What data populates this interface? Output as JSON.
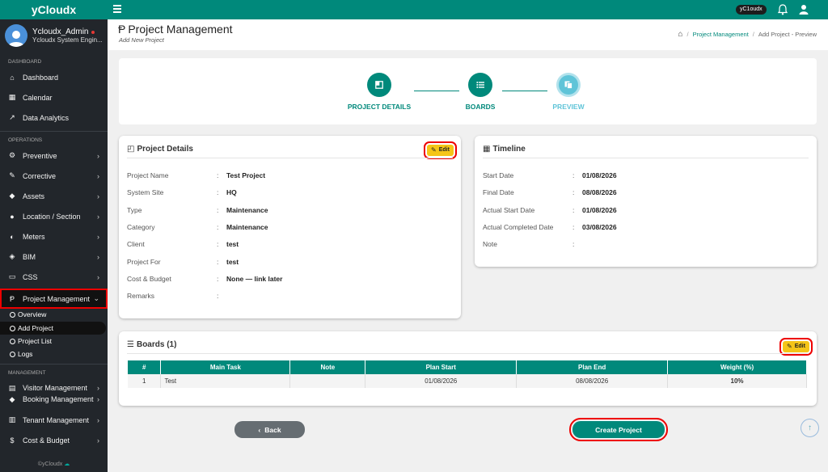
{
  "sidebar": {
    "brand": "yCloudx",
    "user": {
      "name": "Ycloudx_Admin",
      "role": "Ycloudx System Engin..."
    },
    "sections": {
      "dashboard": "DASHBOARD",
      "operations": "OPERATIONS",
      "management": "MANAGEMENT"
    },
    "items": {
      "dashboard": "Dashboard",
      "calendar": "Calendar",
      "data_analytics": "Data Analytics",
      "preventive": "Preventive",
      "corrective": "Corrective",
      "assets": "Assets",
      "location": "Location / Section",
      "meters": "Meters",
      "bim": "BIM",
      "css": "CSS",
      "project_management": "Project Management",
      "visitor_management": "Visitor Management",
      "booking_management": "Booking Management",
      "tenant_management": "Tenant Management",
      "cost_budget": "Cost & Budget"
    },
    "project_sub": {
      "overview": "Overview",
      "add_project": "Add Project",
      "project_list": "Project List",
      "logs": "Logs"
    },
    "footer": "©yCloudx"
  },
  "topbar": {
    "tag": "yC1oudx"
  },
  "header": {
    "title": "Project Management",
    "subtitle": "Add New Project",
    "breadcrumb": {
      "link": "Project Management",
      "current": "Add Project - Preview",
      "sep": "/"
    }
  },
  "stepper": {
    "steps": [
      "PROJECT DETAILS",
      "BOARDS",
      "PREVIEW"
    ]
  },
  "project_details": {
    "title": "Project Details",
    "edit_label": "Edit",
    "rows": [
      {
        "label": "Project Name",
        "value": "Test Project"
      },
      {
        "label": "System Site",
        "value": "HQ"
      },
      {
        "label": "Type",
        "value": "Maintenance"
      },
      {
        "label": "Category",
        "value": "Maintenance"
      },
      {
        "label": "Client",
        "value": "test"
      },
      {
        "label": "Project For",
        "value": "test"
      },
      {
        "label": "Cost & Budget",
        "value": "None — link later"
      },
      {
        "label": "Remarks",
        "value": ""
      }
    ]
  },
  "timeline": {
    "title": "Timeline",
    "rows": [
      {
        "label": "Start Date",
        "value": "01/08/2026"
      },
      {
        "label": "Final Date",
        "value": "08/08/2026"
      },
      {
        "label": "Actual Start Date",
        "value": "01/08/2026"
      },
      {
        "label": "Actual Completed Date",
        "value": "03/08/2026"
      },
      {
        "label": "Note",
        "value": ""
      }
    ]
  },
  "boards": {
    "title": "Boards (1)",
    "edit_label": "Edit",
    "columns": [
      "#",
      "Main Task",
      "Note",
      "Plan Start",
      "Plan End",
      "Weight (%)"
    ],
    "rows": [
      {
        "num": "1",
        "task": "Test",
        "note": "",
        "plan_start": "01/08/2026",
        "plan_end": "08/08/2026",
        "weight": "10%"
      }
    ]
  },
  "colon": ":",
  "buttons": {
    "back": "Back",
    "create": "Create Project"
  },
  "colors": {
    "accent": "#00897b",
    "sidebar": "#22262b",
    "edit": "#f5c518",
    "highlight": "#ee0000"
  }
}
